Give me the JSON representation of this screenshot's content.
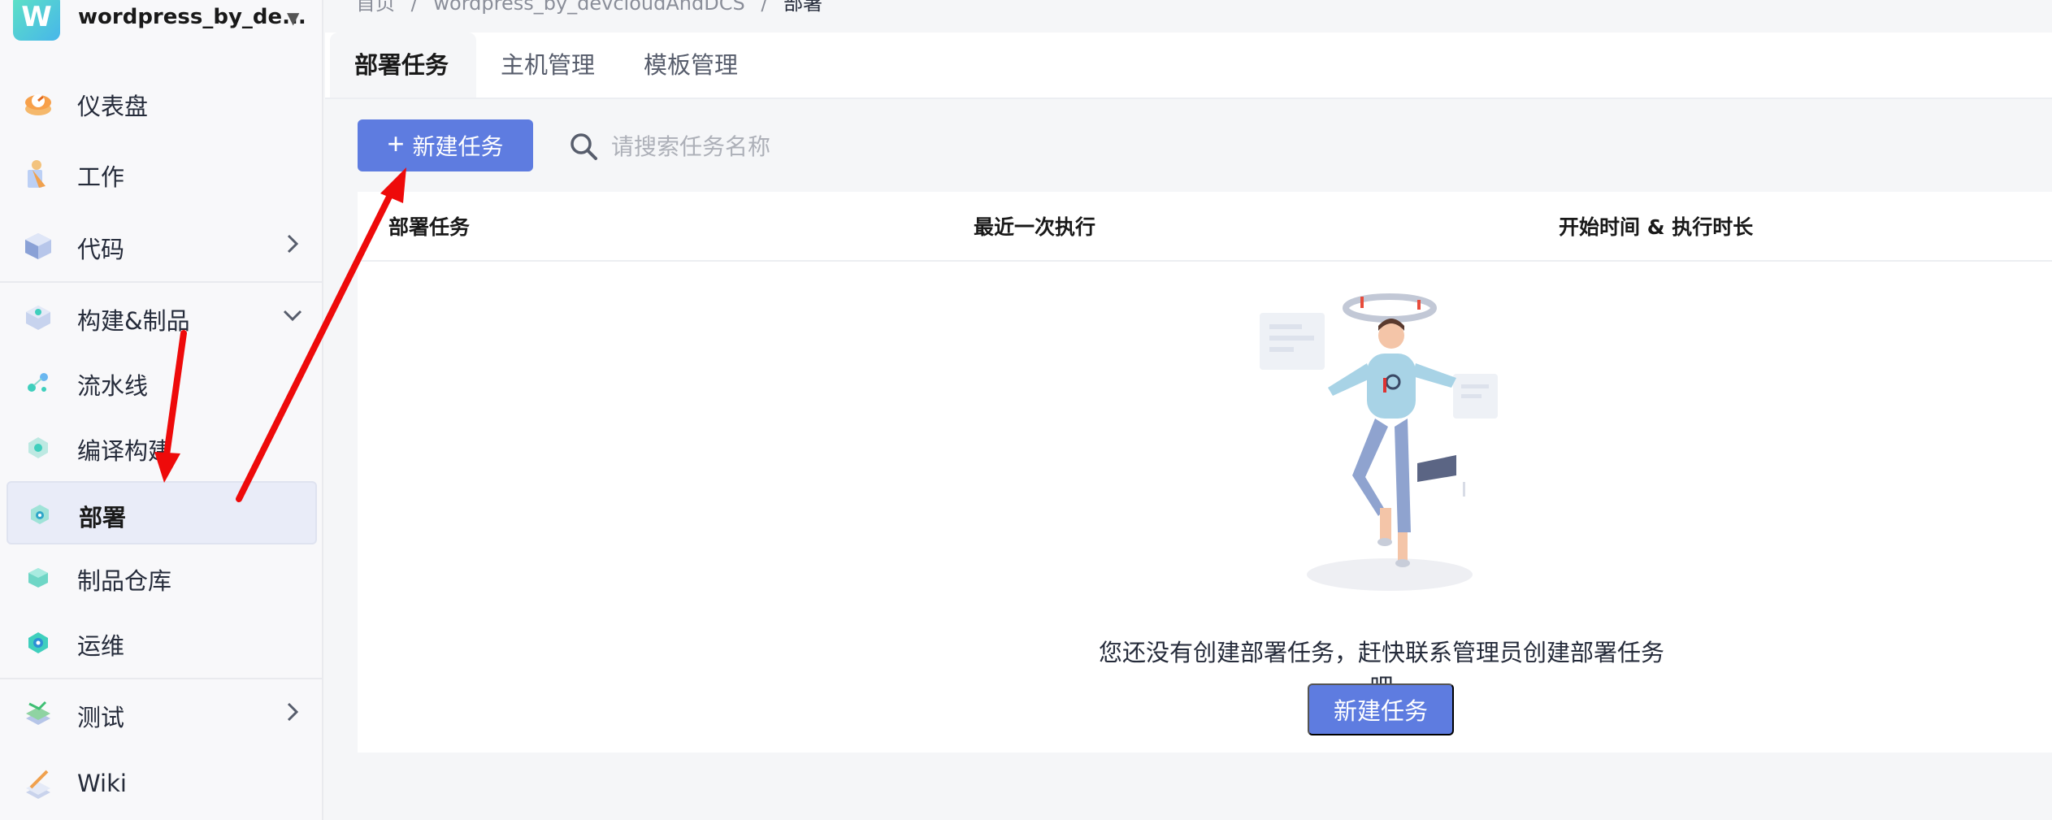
{
  "project": {
    "logo_text": "W",
    "name": "wordpress_by_de..."
  },
  "sidebar": {
    "items": [
      {
        "label": "仪表盘",
        "icon": "dashboard-icon"
      },
      {
        "label": "工作",
        "icon": "work-icon"
      },
      {
        "label": "代码",
        "icon": "code-icon"
      },
      {
        "label": "构建&制品",
        "icon": "build-artifact-icon"
      },
      {
        "label": "流水线",
        "icon": "pipeline-icon"
      },
      {
        "label": "编译构建",
        "icon": "compile-build-icon"
      },
      {
        "label": "部署",
        "icon": "deploy-icon",
        "active": true
      },
      {
        "label": "制品仓库",
        "icon": "artifact-repo-icon"
      },
      {
        "label": "运维",
        "icon": "ops-icon"
      },
      {
        "label": "测试",
        "icon": "test-icon"
      },
      {
        "label": "Wiki",
        "icon": "wiki-icon"
      }
    ]
  },
  "breadcrumb": {
    "home": "首页",
    "sep": "/",
    "project": "wordpress_by_devcloudAndDCS",
    "current": "部署"
  },
  "tabs": [
    {
      "label": "部署任务",
      "active": true
    },
    {
      "label": "主机管理"
    },
    {
      "label": "模板管理"
    }
  ],
  "toolbar": {
    "new_button": "新建任务",
    "plus": "+",
    "search_placeholder": "请搜索任务名称"
  },
  "table": {
    "columns": [
      "部署任务",
      "最近一次执行",
      "开始时间 & 执行时长"
    ]
  },
  "empty": {
    "message": "您还没有创建部署任务，赶快联系管理员创建部署任务吧",
    "button": "新建任务"
  },
  "colors": {
    "primary": "#5e7ce0",
    "annotation": "#ee0a0a"
  }
}
